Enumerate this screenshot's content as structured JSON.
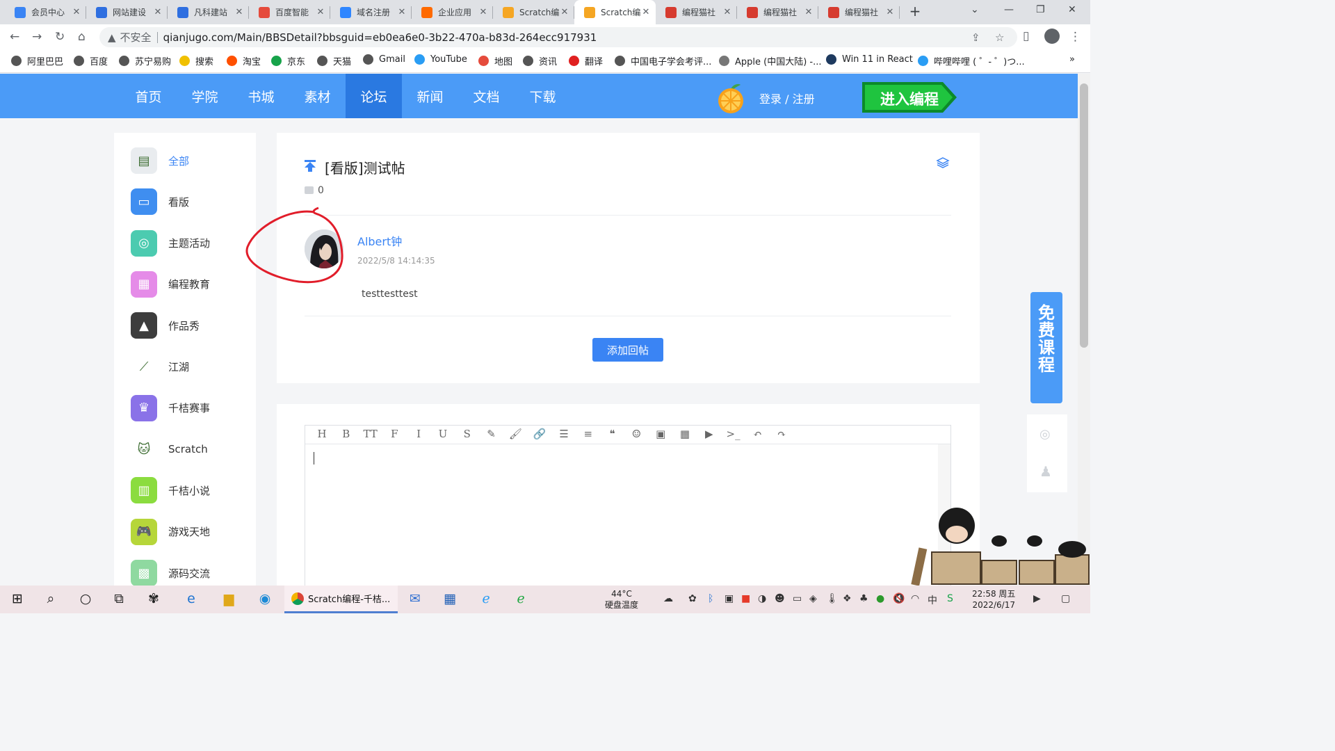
{
  "browser": {
    "tabs": [
      {
        "title": "会员中心",
        "fav_color": "#3a84f4",
        "fav_icon": "member-icon"
      },
      {
        "title": "网站建设",
        "fav_color": "#2f6fe0",
        "fav_icon": "site-icon"
      },
      {
        "title": "凡科建站",
        "fav_color": "#2f6fe0",
        "fav_icon": "site-icon"
      },
      {
        "title": "百度智能",
        "fav_color": "#e54b3c",
        "fav_icon": "baidu-cloud-icon"
      },
      {
        "title": "域名注册",
        "fav_color": "#2f86ff",
        "fav_icon": "cloud-icon"
      },
      {
        "title": "企业应用",
        "fav_color": "#ff6a00",
        "fav_icon": "aliyun-icon"
      },
      {
        "title": "Scratch编",
        "fav_color": "#f5a623",
        "fav_icon": "orange-icon"
      },
      {
        "title": "Scratch编",
        "fav_color": "#f5a623",
        "fav_icon": "orange-icon"
      },
      {
        "title": "编程猫社",
        "fav_color": "#d63b2f",
        "fav_icon": "codemao-icon"
      },
      {
        "title": "编程猫社",
        "fav_color": "#d63b2f",
        "fav_icon": "codemao-icon"
      },
      {
        "title": "编程猫社",
        "fav_color": "#d63b2f",
        "fav_icon": "codemao-icon"
      }
    ],
    "active_tab": 7,
    "new_tab": "+",
    "address": {
      "security_warning": "不安全",
      "url": "qianjugo.com/Main/BBSDetail?bbsguid=eb0ea6e0-3b22-470a-b83d-264ecc917931"
    },
    "bookmarks": [
      {
        "label": "阿里巴巴",
        "color": "#555555"
      },
      {
        "label": "百度",
        "color": "#555555"
      },
      {
        "label": "苏宁易购",
        "color": "#555555"
      },
      {
        "label": "搜索",
        "color": "#f0c000"
      },
      {
        "label": "淘宝",
        "color": "#ff5000"
      },
      {
        "label": "京东",
        "color": "#17a34a"
      },
      {
        "label": "天猫",
        "color": "#555555"
      },
      {
        "label": "Gmail",
        "color": "#555555"
      },
      {
        "label": "YouTube",
        "color": "#2a9df4"
      },
      {
        "label": "地图",
        "color": "#e54b3c"
      },
      {
        "label": "资讯",
        "color": "#555555"
      },
      {
        "label": "翻译",
        "color": "#e02020"
      },
      {
        "label": "中国电子学会考评...",
        "color": "#555555"
      },
      {
        "label": "Apple (中国大陆) -...",
        "color": "#777777"
      },
      {
        "label": "Win 11 in React",
        "color": "#1e3a5f"
      },
      {
        "label": "哔哩哔哩 ( ゜- ゜)つ...",
        "color": "#2a9df4"
      }
    ],
    "bookmarks_more": "»"
  },
  "site": {
    "nav": [
      "首页",
      "学院",
      "书城",
      "素材",
      "论坛",
      "新闻",
      "文档",
      "下载"
    ],
    "active_nav": 4,
    "login": "登录 / 注册",
    "enter_button": "进入编程",
    "colors": {
      "header": "#4b9bf7",
      "active": "#2a79e1",
      "accent": "#3a84f4"
    }
  },
  "sidebar": {
    "items": [
      {
        "label": "全部",
        "icon": "all-icon",
        "color": "#e9ecef",
        "active": true
      },
      {
        "label": "看版",
        "icon": "board-icon",
        "color": "#3f8ef0"
      },
      {
        "label": "主题活动",
        "icon": "target-icon",
        "color": "#4ccbb0"
      },
      {
        "label": "编程教育",
        "icon": "education-icon",
        "color": "#e58be8"
      },
      {
        "label": "作品秀",
        "icon": "showcase-icon",
        "color": "#3d3d3d"
      },
      {
        "label": "江湖",
        "icon": "sword-icon",
        "color": "#ffffff"
      },
      {
        "label": "千桔赛事",
        "icon": "trophy-icon",
        "color": "#8a72e8"
      },
      {
        "label": "Scratch",
        "icon": "scratch-cat-icon",
        "color": "#ffffff"
      },
      {
        "label": "千桔小说",
        "icon": "novel-icon",
        "color": "#8bdc3f"
      },
      {
        "label": "游戏天地",
        "icon": "game-icon",
        "color": "#b6d63a"
      },
      {
        "label": "源码交流",
        "icon": "code-icon",
        "color": "#8fd9a0"
      }
    ]
  },
  "post": {
    "title": "[看版]测试帖",
    "comment_count": "0",
    "author": "Albert钟",
    "date": "2022/5/8 14:14:35",
    "content": "testtesttest",
    "reply_button": "添加回帖"
  },
  "editor": {
    "tools": [
      "H",
      "B",
      "TT",
      "F",
      "I",
      "U",
      "S",
      "✎",
      "🖌",
      "🔗",
      "☰",
      "≡",
      "❝",
      "☺",
      "▣",
      "▦",
      "▶",
      ">_",
      "↶",
      "↷"
    ]
  },
  "widgets": {
    "free_course": "免费课程"
  },
  "taskbar": {
    "active_app": "Scratch编程-千桔...",
    "temp": "44°C",
    "temp_label": "硬盘温度",
    "time": "22:58 周五",
    "date": "2022/6/17",
    "ime": "中"
  }
}
